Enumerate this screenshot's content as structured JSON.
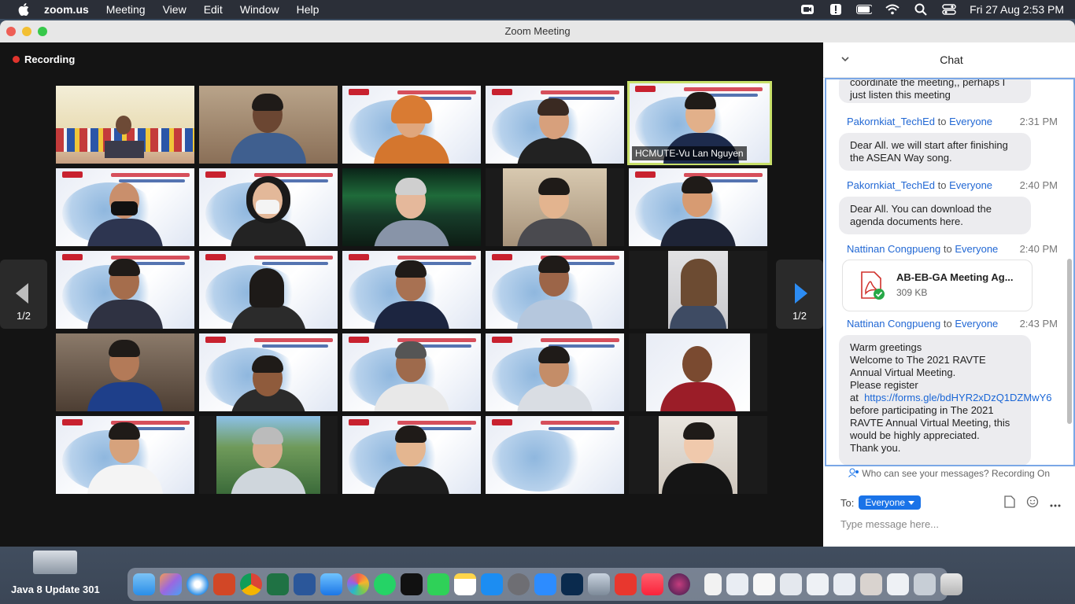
{
  "menubar": {
    "app_name": "zoom.us",
    "items": [
      "Meeting",
      "View",
      "Edit",
      "Window",
      "Help"
    ],
    "datetime": "Fri 27 Aug  2:53 PM"
  },
  "window": {
    "title": "Zoom Meeting"
  },
  "recording": {
    "label": "Recording"
  },
  "gallery": {
    "active_speaker_label": "HCMUTE-Vu Lan Nguyen",
    "page_left": "1/2",
    "page_right": "1/2"
  },
  "chat": {
    "title": "Chat",
    "messages": [
      {
        "text": "coordinate the meeting,, perhaps I just listen this meeting"
      },
      {
        "sender": "Pakornkiat_TechEd",
        "to_word": "to",
        "recipient": "Everyone",
        "time": "2:31 PM",
        "text": "Dear All. we will start after finishing the ASEAN Way song."
      },
      {
        "sender": "Pakornkiat_TechEd",
        "to_word": "to",
        "recipient": "Everyone",
        "time": "2:40 PM",
        "text": "Dear All. You can download the agenda documents here."
      },
      {
        "sender": "Nattinan Congpueng",
        "to_word": "to",
        "recipient": "Everyone",
        "time": "2:40 PM",
        "file_name": "AB-EB-GA Meeting Ag...",
        "file_size": "309 KB"
      },
      {
        "sender": "Nattinan Congpueng",
        "to_word": "to",
        "recipient": "Everyone",
        "time": "2:43 PM",
        "lines": [
          "Warm greetings",
          "Welcome to The 2021 RAVTE Annual Virtual Meeting.",
          "Please register at",
          "https://forms.gle/bdHYR2xDzQ1DZMwY6",
          "before participating in The 2021 RAVTE Annual Virtual Meeting, this would be highly appreciated.",
          "Thank you."
        ]
      }
    ],
    "who_can_see": "Who can see your messages? Recording On",
    "to_label": "To:",
    "to_value": "Everyone",
    "input_placeholder": "Type message here..."
  },
  "dock": {
    "java_label": "Java 8 Update 301"
  },
  "colors": {
    "zoom_blue": "#2268d4",
    "recording_red": "#e0342d",
    "active_outline": "#c8e06a"
  }
}
